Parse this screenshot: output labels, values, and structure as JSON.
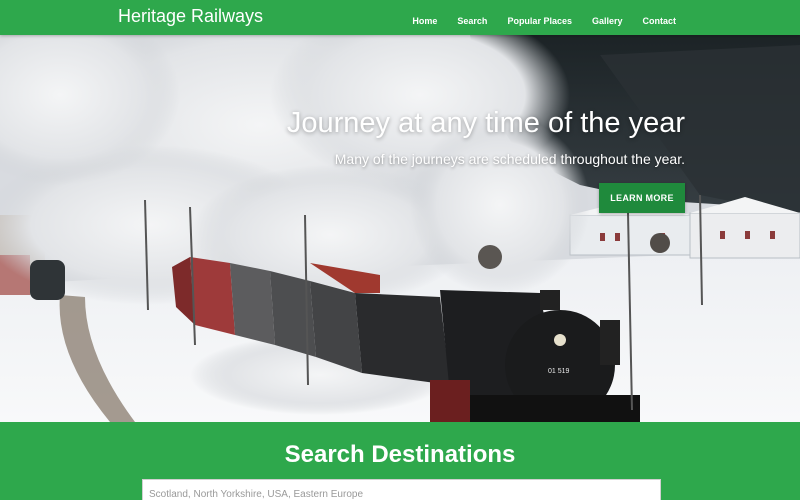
{
  "brand": "Heritage Railways",
  "nav": [
    {
      "label": "Home"
    },
    {
      "label": "Search"
    },
    {
      "label": "Popular Places"
    },
    {
      "label": "Gallery"
    },
    {
      "label": "Contact"
    }
  ],
  "hero": {
    "title": "Journey at any time of the year",
    "subtitle": "Many of the journeys are scheduled throughout the year.",
    "button_label": "LEARN MORE",
    "image_alt": "steam-locomotive-in-snow"
  },
  "search": {
    "title": "Search Destinations",
    "placeholder": "Scotland, North Yorkshire, USA, Eastern Europe",
    "value": ""
  },
  "locomotive_number": "01 519",
  "colors": {
    "primary": "#2ea84c",
    "button": "#1f8a3c"
  }
}
